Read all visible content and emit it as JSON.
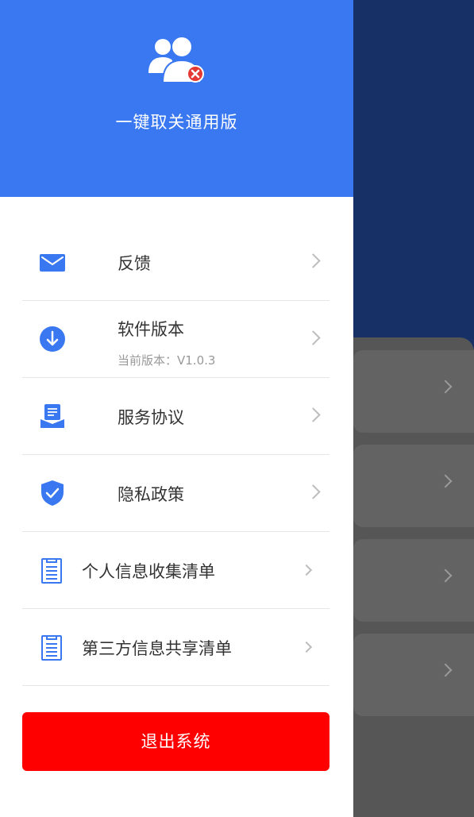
{
  "app": {
    "name": "一键取关通用版",
    "logo_icon": "users-remove-icon"
  },
  "colors": {
    "header_blue": "#3a78f2",
    "icon_blue": "#3a78f2",
    "logout_red": "#ff0000",
    "background_navy": "#173066"
  },
  "menu": {
    "items": [
      {
        "label": "反馈",
        "icon": "mail-icon"
      },
      {
        "label": "软件版本",
        "sublabel": "当前版本：V1.0.3",
        "icon": "download-icon"
      },
      {
        "label": "服务协议",
        "icon": "agreement-icon"
      },
      {
        "label": "隐私政策",
        "icon": "shield-check-icon"
      },
      {
        "label": "个人信息收集清单",
        "icon": "document-list-icon"
      },
      {
        "label": "第三方信息共享清单",
        "icon": "document-list-icon"
      }
    ]
  },
  "logout": {
    "label": "退出系统"
  }
}
